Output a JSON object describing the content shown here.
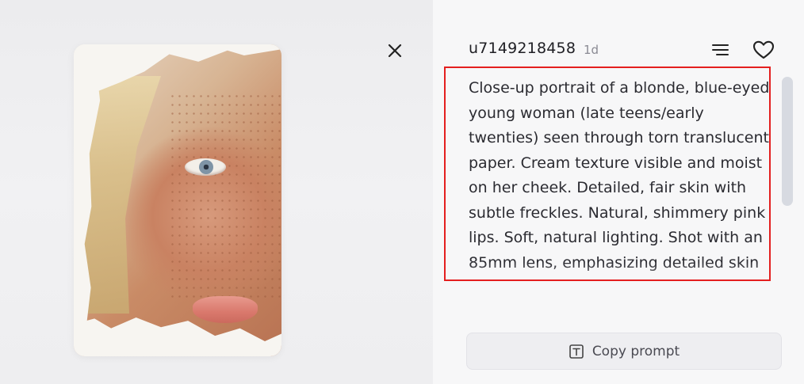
{
  "header": {
    "username": "u7149218458",
    "age": "1d"
  },
  "icons": {
    "close": "close-icon",
    "menu": "filter-lines-icon",
    "like": "heart-icon",
    "copy": "text-box-icon"
  },
  "prompt": {
    "text": "Close-up portrait of a blonde, blue-eyed young woman (late teens/early twenties) seen through torn translucent paper. Cream texture visible and moist on her cheek. Detailed, fair skin with subtle freckles. Natural, shimmery pink lips. Soft, natural lighting. Shot with an 85mm lens, emphasizing detailed skin"
  },
  "actions": {
    "copy_label": "Copy prompt"
  },
  "colors": {
    "highlight_border": "#e41f1f"
  }
}
